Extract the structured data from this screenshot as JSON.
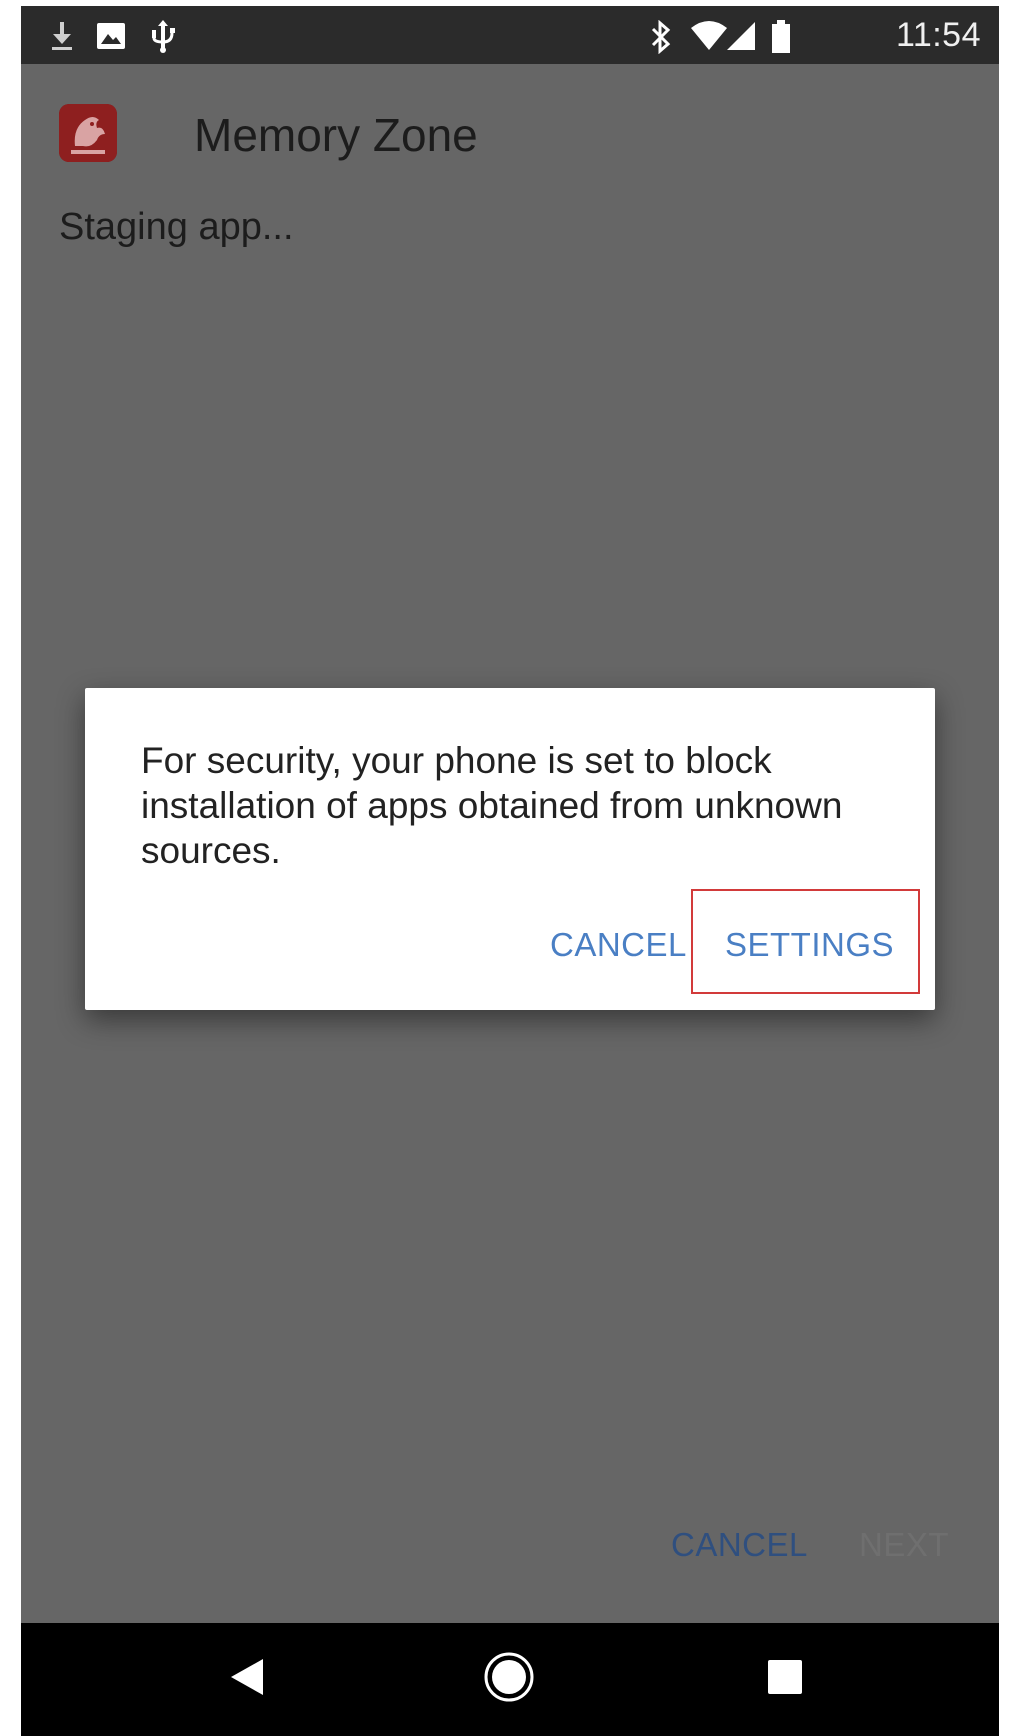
{
  "status_bar": {
    "time": "11:54",
    "left_icons": [
      "download-icon",
      "image-icon",
      "usb-icon"
    ],
    "right_icons": [
      "bluetooth-icon",
      "wifi-icon",
      "signal-icon",
      "battery-icon"
    ]
  },
  "app": {
    "title": "Memory Zone",
    "status": "Staging app..."
  },
  "dialog": {
    "message": "For security, your phone is set to block installation of apps obtained from unknown sources.",
    "cancel_label": "CANCEL",
    "settings_label": "SETTINGS"
  },
  "bottom_actions": {
    "cancel_label": "CANCEL",
    "next_label": "NEXT"
  },
  "nav": {
    "icons": [
      "back-icon",
      "home-icon",
      "recents-icon"
    ]
  },
  "colors": {
    "accent": "#4a7fc4",
    "highlight": "#d23a3a",
    "scrim": "#666666"
  }
}
